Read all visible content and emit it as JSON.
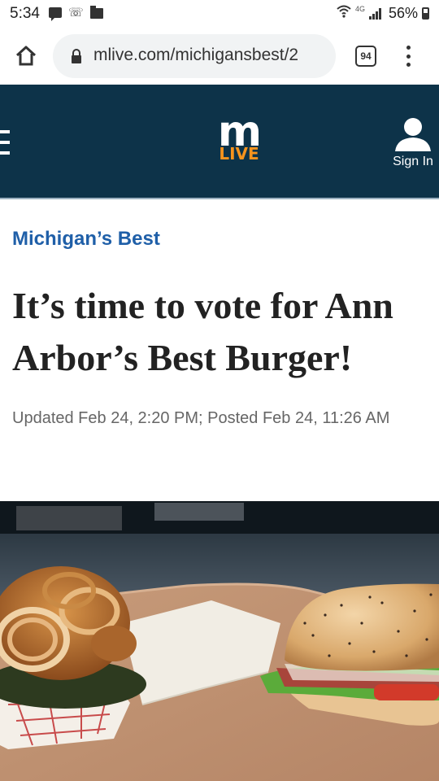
{
  "status_bar": {
    "time": "5:34",
    "network": "4G",
    "battery": "56%"
  },
  "browser": {
    "url": "mlive.com/michigansbest/2",
    "tab_count": "94"
  },
  "site": {
    "logo_top": "m",
    "logo_bottom": "LIVE",
    "sign_in_label": "Sign In",
    "brand_navy": "#0d3349",
    "brand_orange": "#f7941d"
  },
  "article": {
    "kicker": "Michigan’s Best",
    "headline_line1": "It’s time to vote for Ann",
    "headline_line2": "Arbor’s Best Burger!",
    "timestamp": "Updated Feb 24, 2:20 PM; Posted Feb 24, 11:26 AM"
  },
  "icons": {
    "status_left": [
      "message-icon",
      "missed-call-icon",
      "folder-icon"
    ],
    "status_right": [
      "wifi-icon",
      "signal-icon",
      "battery-icon"
    ],
    "browser": [
      "home-icon",
      "lock-icon",
      "tab-switcher-icon",
      "overflow-menu-icon"
    ],
    "header": [
      "hamburger-menu-icon",
      "user-icon"
    ]
  }
}
